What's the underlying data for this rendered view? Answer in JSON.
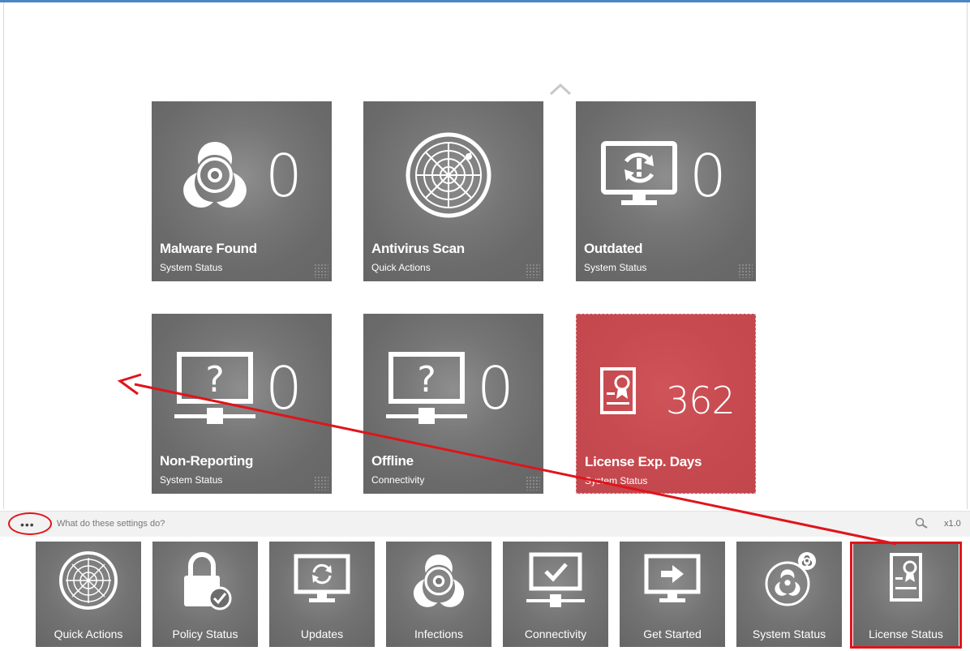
{
  "dashboard": {
    "tiles": [
      {
        "title": "Malware Found",
        "subtitle": "System Status",
        "count": "0",
        "icon": "biohazard-icon"
      },
      {
        "title": "Antivirus Scan",
        "subtitle": "Quick Actions",
        "count": "",
        "icon": "radar-icon"
      },
      {
        "title": "Outdated",
        "subtitle": "System Status",
        "count": "0",
        "icon": "monitor-update-icon"
      },
      {
        "title": "Non-Reporting",
        "subtitle": "System Status",
        "count": "0",
        "icon": "monitor-question-icon"
      },
      {
        "title": "Offline",
        "subtitle": "Connectivity",
        "count": "0",
        "icon": "monitor-question-icon"
      },
      {
        "title": "License Exp. Days",
        "subtitle": "System Status",
        "count": "362",
        "icon": "license-certificate-icon"
      }
    ]
  },
  "settings_bar": {
    "dots": "•••",
    "help_text": "What do these settings do?",
    "zoom": "x1.0"
  },
  "dock": {
    "items": [
      {
        "label": "Quick Actions",
        "icon": "radar-icon"
      },
      {
        "label": "Policy Status",
        "icon": "lock-check-icon"
      },
      {
        "label": "Updates",
        "icon": "monitor-sync-icon"
      },
      {
        "label": "Infections",
        "icon": "biohazard-icon"
      },
      {
        "label": "Connectivity",
        "icon": "monitor-check-icon"
      },
      {
        "label": "Get Started",
        "icon": "monitor-arrow-icon"
      },
      {
        "label": "System Status",
        "icon": "biohazard-badge-icon"
      },
      {
        "label": "License Status",
        "icon": "license-certificate-icon"
      }
    ]
  },
  "colors": {
    "tile_gray": "#6c6c6c",
    "tile_red": "#c4484e",
    "annotation_red": "#e0141b",
    "top_accent": "#4a86c5"
  }
}
